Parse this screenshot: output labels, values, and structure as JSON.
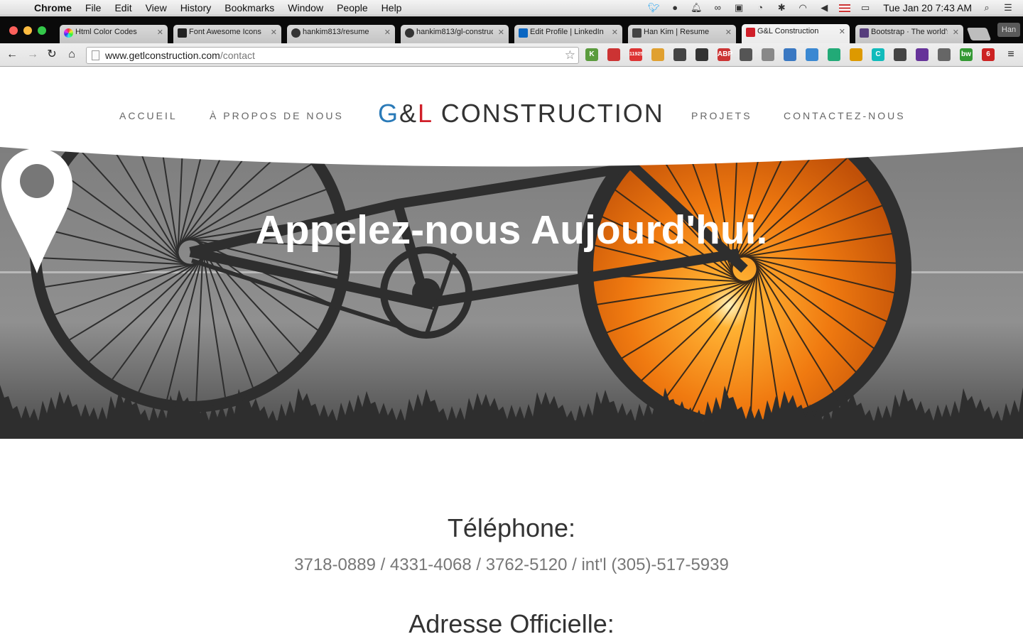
{
  "menubar": {
    "app": "Chrome",
    "items": [
      "File",
      "Edit",
      "View",
      "History",
      "Bookmarks",
      "Window",
      "People",
      "Help"
    ],
    "clock": "Tue Jan 20  7:43 AM"
  },
  "tabs": [
    {
      "label": "Html Color Codes",
      "color": "#e54"
    },
    {
      "label": "Font Awesome Icons",
      "color": "#222"
    },
    {
      "label": "hankim813/resume",
      "color": "#333"
    },
    {
      "label": "hankim813/gl-construction",
      "color": "#333"
    },
    {
      "label": "Edit Profile | LinkedIn",
      "color": "#0a66c2"
    },
    {
      "label": "Han Kim | Resume",
      "color": "#444"
    },
    {
      "label": "G&L Construction",
      "color": "#d0202a"
    },
    {
      "label": "Bootstrap · The world's",
      "color": "#563d7c"
    }
  ],
  "profile": "Han",
  "address": {
    "host": "www.getlconstruction.com",
    "path": "/contact"
  },
  "extensions": [
    {
      "label": "K",
      "color": "#5a9b3d"
    },
    {
      "label": "",
      "color": "#c33"
    },
    {
      "label": "11925",
      "color": "#d33"
    },
    {
      "label": "",
      "color": "#e0a030"
    },
    {
      "label": "",
      "color": "#444"
    },
    {
      "label": "",
      "color": "#333"
    },
    {
      "label": "ABP",
      "color": "#c33"
    },
    {
      "label": "",
      "color": "#555"
    },
    {
      "label": "",
      "color": "#888"
    },
    {
      "label": "",
      "color": "#3a78c2"
    },
    {
      "label": "",
      "color": "#3a88d2"
    },
    {
      "label": "",
      "color": "#2a7"
    },
    {
      "label": "",
      "color": "#d90"
    },
    {
      "label": "C",
      "color": "#1bb"
    },
    {
      "label": "",
      "color": "#444"
    },
    {
      "label": "",
      "color": "#639"
    },
    {
      "label": "",
      "color": "#666"
    },
    {
      "label": "bw",
      "color": "#393"
    },
    {
      "label": "6",
      "color": "#c22"
    }
  ],
  "site": {
    "brand_g": "G",
    "brand_amp": "&",
    "brand_l": "L",
    "brand_rest": " CONSTRUCTION",
    "nav": {
      "home": "ACCUEIL",
      "about": "À PROPOS DE NOUS",
      "projects": "PROJETS",
      "contact": "CONTACTEZ-NOUS"
    },
    "hero_title": "Appelez-nous Aujourd'hui.",
    "phone_heading": "Téléphone:",
    "phone_numbers": "3718-0889 / 4331-4068 / 3762-5120 / int'l (305)-517-5939",
    "address_heading": "Adresse Officielle:"
  }
}
